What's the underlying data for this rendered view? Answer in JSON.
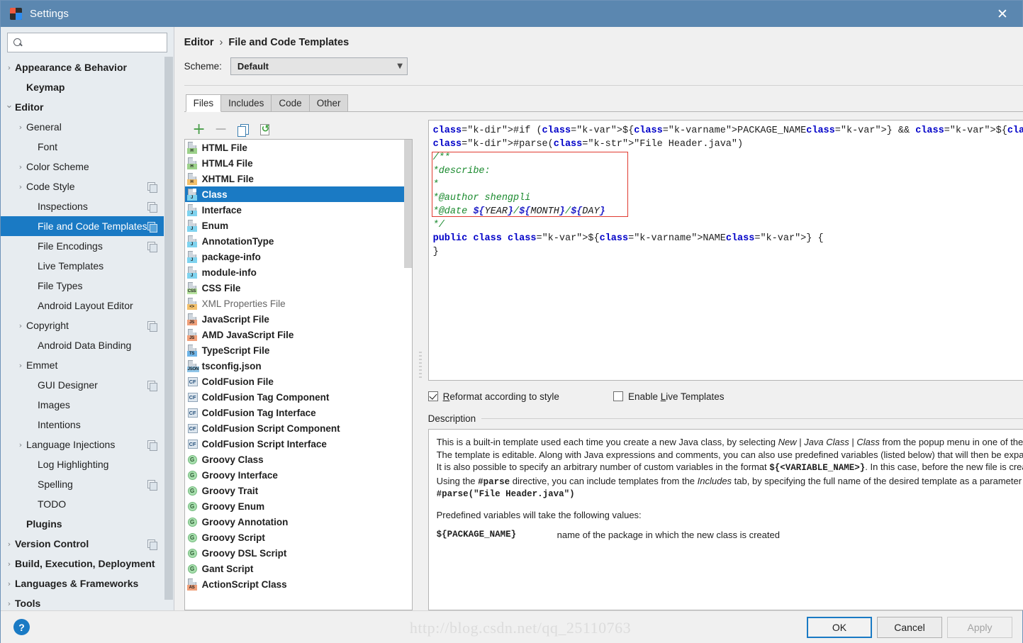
{
  "window": {
    "title": "Settings",
    "close_icon": "close-icon",
    "app_icon": "intellij-logo"
  },
  "search": {
    "value": "",
    "placeholder": "",
    "icon": "search-icon"
  },
  "sidebar": {
    "items": [
      {
        "label": "Appearance & Behavior",
        "arrow": "›",
        "indent": 0,
        "bold": true,
        "badge": false,
        "selected": false
      },
      {
        "label": "Keymap",
        "arrow": "",
        "indent": 1,
        "bold": true,
        "badge": false,
        "selected": false
      },
      {
        "label": "Editor",
        "arrow": "⌄",
        "indent": 0,
        "bold": true,
        "badge": false,
        "selected": false
      },
      {
        "label": "General",
        "arrow": "›",
        "indent": 1,
        "bold": false,
        "badge": false,
        "selected": false
      },
      {
        "label": "Font",
        "arrow": "",
        "indent": 2,
        "bold": false,
        "badge": false,
        "selected": false
      },
      {
        "label": "Color Scheme",
        "arrow": "›",
        "indent": 1,
        "bold": false,
        "badge": false,
        "selected": false
      },
      {
        "label": "Code Style",
        "arrow": "›",
        "indent": 1,
        "bold": false,
        "badge": true,
        "selected": false
      },
      {
        "label": "Inspections",
        "arrow": "",
        "indent": 2,
        "bold": false,
        "badge": true,
        "selected": false
      },
      {
        "label": "File and Code Templates",
        "arrow": "",
        "indent": 2,
        "bold": false,
        "badge": true,
        "selected": true
      },
      {
        "label": "File Encodings",
        "arrow": "",
        "indent": 2,
        "bold": false,
        "badge": true,
        "selected": false
      },
      {
        "label": "Live Templates",
        "arrow": "",
        "indent": 2,
        "bold": false,
        "badge": false,
        "selected": false
      },
      {
        "label": "File Types",
        "arrow": "",
        "indent": 2,
        "bold": false,
        "badge": false,
        "selected": false
      },
      {
        "label": "Android Layout Editor",
        "arrow": "",
        "indent": 2,
        "bold": false,
        "badge": false,
        "selected": false
      },
      {
        "label": "Copyright",
        "arrow": "›",
        "indent": 1,
        "bold": false,
        "badge": true,
        "selected": false
      },
      {
        "label": "Android Data Binding",
        "arrow": "",
        "indent": 2,
        "bold": false,
        "badge": false,
        "selected": false
      },
      {
        "label": "Emmet",
        "arrow": "›",
        "indent": 1,
        "bold": false,
        "badge": false,
        "selected": false
      },
      {
        "label": "GUI Designer",
        "arrow": "",
        "indent": 2,
        "bold": false,
        "badge": true,
        "selected": false
      },
      {
        "label": "Images",
        "arrow": "",
        "indent": 2,
        "bold": false,
        "badge": false,
        "selected": false
      },
      {
        "label": "Intentions",
        "arrow": "",
        "indent": 2,
        "bold": false,
        "badge": false,
        "selected": false
      },
      {
        "label": "Language Injections",
        "arrow": "›",
        "indent": 1,
        "bold": false,
        "badge": true,
        "selected": false
      },
      {
        "label": "Log Highlighting",
        "arrow": "",
        "indent": 2,
        "bold": false,
        "badge": false,
        "selected": false
      },
      {
        "label": "Spelling",
        "arrow": "",
        "indent": 2,
        "bold": false,
        "badge": true,
        "selected": false
      },
      {
        "label": "TODO",
        "arrow": "",
        "indent": 2,
        "bold": false,
        "badge": false,
        "selected": false
      },
      {
        "label": "Plugins",
        "arrow": "",
        "indent": 1,
        "bold": true,
        "badge": false,
        "selected": false
      },
      {
        "label": "Version Control",
        "arrow": "›",
        "indent": 0,
        "bold": true,
        "badge": true,
        "selected": false
      },
      {
        "label": "Build, Execution, Deployment",
        "arrow": "›",
        "indent": 0,
        "bold": true,
        "badge": false,
        "selected": false
      },
      {
        "label": "Languages & Frameworks",
        "arrow": "›",
        "indent": 0,
        "bold": true,
        "badge": false,
        "selected": false
      },
      {
        "label": "Tools",
        "arrow": "›",
        "indent": 0,
        "bold": true,
        "badge": false,
        "selected": false
      }
    ]
  },
  "breadcrumb": {
    "root": "Editor",
    "separator": "›",
    "leaf": "File and Code Templates"
  },
  "scheme": {
    "label": "Scheme:",
    "value": "Default",
    "chevron_icon": "chevron-down-icon"
  },
  "tabs": [
    {
      "label": "Files",
      "active": true
    },
    {
      "label": "Includes",
      "active": false
    },
    {
      "label": "Code",
      "active": false
    },
    {
      "label": "Other",
      "active": false
    }
  ],
  "list_toolbar": [
    {
      "name": "add-template-button",
      "glyph": "+",
      "kind": "plus"
    },
    {
      "name": "remove-template-button",
      "glyph": "−",
      "kind": "minus"
    },
    {
      "name": "copy-template-button",
      "glyph": "",
      "kind": "copy"
    },
    {
      "name": "reset-template-button",
      "glyph": "",
      "kind": "reset"
    }
  ],
  "templates": [
    {
      "label": "HTML File",
      "icon": "file-html-icon",
      "tag": "H",
      "style": "sheet",
      "tagbg": "#9cd18a",
      "selected": false,
      "dim": false
    },
    {
      "label": "HTML4 File",
      "icon": "file-html4-icon",
      "tag": "H",
      "style": "sheet",
      "tagbg": "#9cd18a",
      "selected": false,
      "dim": false
    },
    {
      "label": "XHTML File",
      "icon": "file-xhtml-icon",
      "tag": "H",
      "style": "sheet",
      "tagbg": "#f3c06b",
      "selected": false,
      "dim": false
    },
    {
      "label": "Class",
      "icon": "file-java-class-icon",
      "tag": "J",
      "style": "sheet",
      "tagbg": "#7fd3ef",
      "selected": true,
      "dim": false
    },
    {
      "label": "Interface",
      "icon": "file-java-interface-icon",
      "tag": "J",
      "style": "sheet",
      "tagbg": "#7fd3ef",
      "selected": false,
      "dim": false
    },
    {
      "label": "Enum",
      "icon": "file-java-enum-icon",
      "tag": "J",
      "style": "sheet",
      "tagbg": "#7fd3ef",
      "selected": false,
      "dim": false
    },
    {
      "label": "AnnotationType",
      "icon": "file-java-annotation-icon",
      "tag": "J",
      "style": "sheet",
      "tagbg": "#7fd3ef",
      "selected": false,
      "dim": false
    },
    {
      "label": "package-info",
      "icon": "file-package-info-icon",
      "tag": "J",
      "style": "sheet",
      "tagbg": "#7fd3ef",
      "selected": false,
      "dim": false
    },
    {
      "label": "module-info",
      "icon": "file-module-info-icon",
      "tag": "J",
      "style": "sheet",
      "tagbg": "#7fd3ef",
      "selected": false,
      "dim": false
    },
    {
      "label": "CSS File",
      "icon": "file-css-icon",
      "tag": "CSS",
      "style": "sheet",
      "tagbg": "#b8e4a0",
      "selected": false,
      "dim": false
    },
    {
      "label": "XML Properties File",
      "icon": "file-xml-icon",
      "tag": "<>",
      "style": "sheet",
      "tagbg": "#f3c06b",
      "selected": false,
      "dim": true
    },
    {
      "label": "JavaScript File",
      "icon": "file-js-icon",
      "tag": "JS",
      "style": "sheet",
      "tagbg": "#f0a07a",
      "selected": false,
      "dim": false
    },
    {
      "label": "AMD JavaScript File",
      "icon": "file-amd-js-icon",
      "tag": "JS",
      "style": "sheet",
      "tagbg": "#f0a07a",
      "selected": false,
      "dim": false
    },
    {
      "label": "TypeScript File",
      "icon": "file-ts-icon",
      "tag": "TS",
      "style": "sheet",
      "tagbg": "#6fb5e8",
      "selected": false,
      "dim": false
    },
    {
      "label": "tsconfig.json",
      "icon": "file-json-icon",
      "tag": "JSON",
      "style": "sheet",
      "tagbg": "#8fc5e8",
      "selected": false,
      "dim": false
    },
    {
      "label": "ColdFusion File",
      "icon": "file-coldfusion-icon",
      "tag": "CF",
      "style": "box",
      "tagbg": "#dde6ee",
      "selected": false,
      "dim": false
    },
    {
      "label": "ColdFusion Tag Component",
      "icon": "file-coldfusion-icon",
      "tag": "CF",
      "style": "box",
      "tagbg": "#dde6ee",
      "selected": false,
      "dim": false
    },
    {
      "label": "ColdFusion Tag Interface",
      "icon": "file-coldfusion-icon",
      "tag": "CF",
      "style": "box",
      "tagbg": "#dde6ee",
      "selected": false,
      "dim": false
    },
    {
      "label": "ColdFusion Script Component",
      "icon": "file-coldfusion-icon",
      "tag": "CF",
      "style": "box",
      "tagbg": "#dde6ee",
      "selected": false,
      "dim": false
    },
    {
      "label": "ColdFusion Script Interface",
      "icon": "file-coldfusion-icon",
      "tag": "CF",
      "style": "box",
      "tagbg": "#dde6ee",
      "selected": false,
      "dim": false
    },
    {
      "label": "Groovy Class",
      "icon": "file-groovy-icon",
      "tag": "G",
      "style": "round",
      "tagbg": "#a8dfae",
      "selected": false,
      "dim": false
    },
    {
      "label": "Groovy Interface",
      "icon": "file-groovy-icon",
      "tag": "G",
      "style": "round",
      "tagbg": "#a8dfae",
      "selected": false,
      "dim": false
    },
    {
      "label": "Groovy Trait",
      "icon": "file-groovy-icon",
      "tag": "G",
      "style": "round",
      "tagbg": "#a8dfae",
      "selected": false,
      "dim": false
    },
    {
      "label": "Groovy Enum",
      "icon": "file-groovy-icon",
      "tag": "G",
      "style": "round",
      "tagbg": "#a8dfae",
      "selected": false,
      "dim": false
    },
    {
      "label": "Groovy Annotation",
      "icon": "file-groovy-icon",
      "tag": "G",
      "style": "round",
      "tagbg": "#a8dfae",
      "selected": false,
      "dim": false
    },
    {
      "label": "Groovy Script",
      "icon": "file-groovy-icon",
      "tag": "G",
      "style": "round",
      "tagbg": "#a8dfae",
      "selected": false,
      "dim": false
    },
    {
      "label": "Groovy DSL Script",
      "icon": "file-groovy-icon",
      "tag": "G",
      "style": "round",
      "tagbg": "#a8dfae",
      "selected": false,
      "dim": false
    },
    {
      "label": "Gant Script",
      "icon": "file-groovy-icon",
      "tag": "G",
      "style": "round",
      "tagbg": "#a8dfae",
      "selected": false,
      "dim": false
    },
    {
      "label": "ActionScript Class",
      "icon": "file-actionscript-icon",
      "tag": "AS",
      "style": "sheet",
      "tagbg": "#f0a07a",
      "selected": false,
      "dim": false
    }
  ],
  "editor": {
    "lines": [
      "#if (${PACKAGE_NAME} && ${PACKAGE_NAME} != \"\")package ${PACKAGE_NAME};#end",
      "#parse(\"File Header.java\")",
      "/**",
      "*describe:",
      "*",
      "*@author shengpli",
      "*@date ${YEAR}/${MONTH}/${DAY}",
      "*/",
      "public class ${NAME} {",
      "}"
    ]
  },
  "options": {
    "reformat": {
      "label_pre": "R",
      "label_rest": "eformat according to style",
      "checked": true
    },
    "live_templates": {
      "label_pre": "Enable ",
      "label_u": "L",
      "label_rest": "ive Templates",
      "checked": false
    }
  },
  "description": {
    "title": "Description",
    "p1_a": "This is a built-in template used each time you create a new Java class, by selecting ",
    "p1_i1": "New",
    "p1_b1": " | ",
    "p1_i2": "Java Class",
    "p1_b2": " | ",
    "p1_i3": "Class",
    "p1_c": " from the popup menu in one of the project views.",
    "p2": "The template is editable. Along with Java expressions and comments, you can also use predefined variables (listed below) that will then be expanded like macros into the corresponding values.",
    "p3_a": "It is also possible to specify an arbitrary number of custom variables in the format ",
    "p3_mono": "${<VARIABLE_NAME>}",
    "p3_b": ". In this case, before the new file is created, you will be prompted with a dialog where you can define particular values for all custom variables.",
    "p4_a": "Using the ",
    "p4_mono": "#parse",
    "p4_b": " directive, you can include templates from the ",
    "p4_i": "Includes",
    "p4_c": " tab, by specifying the full name of the desired template as a parameter in quotation marks. For example:",
    "p5_mono": "#parse(\"File Header.java\")",
    "p6": "Predefined variables will take the following values:",
    "var_name": "${PACKAGE_NAME}",
    "var_desc": "name of the package in which the new class is created"
  },
  "footer": {
    "help_icon": "help-icon",
    "help_glyph": "?",
    "ok": "OK",
    "cancel": "Cancel",
    "apply": "Apply",
    "watermark": "http://blog.csdn.net/qq_25110763"
  }
}
